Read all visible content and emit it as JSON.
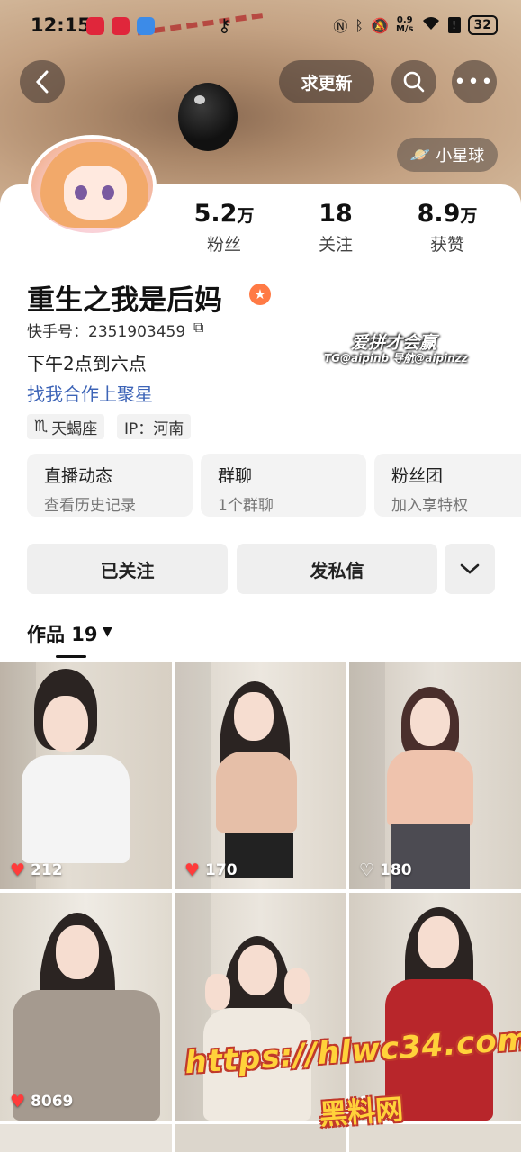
{
  "status_bar": {
    "time": "12:15",
    "net_speed_value": "0.9",
    "net_speed_unit": "M/s",
    "battery": "32"
  },
  "nav": {
    "update_label": "求更新",
    "planet_label": "小星球"
  },
  "profile": {
    "stats": [
      {
        "value": "5.2",
        "unit": "万",
        "label": "粉丝"
      },
      {
        "value": "18",
        "unit": "",
        "label": "关注"
      },
      {
        "value": "8.9",
        "unit": "万",
        "label": "获赞"
      }
    ],
    "name": "重生之我是后妈",
    "kuaishou_id": "快手号：2351903459",
    "bio": "下午2点到六点",
    "cooperation": "找我合作上聚星",
    "tags": [
      "天蝎座",
      "IP：河南"
    ],
    "entries": [
      {
        "title": "直播动态",
        "subtitle": "查看历史记录"
      },
      {
        "title": "群聊",
        "subtitle": "1个群聊"
      },
      {
        "title": "粉丝团",
        "subtitle": "加入享特权"
      }
    ],
    "actions": {
      "followed": "已关注",
      "message": "发私信"
    }
  },
  "overlay_watermark": {
    "line1": "爱拼才会赢",
    "line2": "TG@aipinb 导航@aipinzz",
    "big1": "https://hlwc34.com",
    "big2": "黑料网"
  },
  "works": {
    "label": "作品 19",
    "items": [
      {
        "likes": "212",
        "liked": true
      },
      {
        "likes": "170",
        "liked": true
      },
      {
        "likes": "180",
        "liked": false
      },
      {
        "likes": "8069",
        "liked": true
      },
      {
        "likes": "",
        "liked": false
      },
      {
        "likes": "9",
        "liked": false
      }
    ]
  },
  "colors": {
    "accent_link": "#3d64b7",
    "badge": "#ff7a45",
    "like_red": "#ff3b3b"
  }
}
